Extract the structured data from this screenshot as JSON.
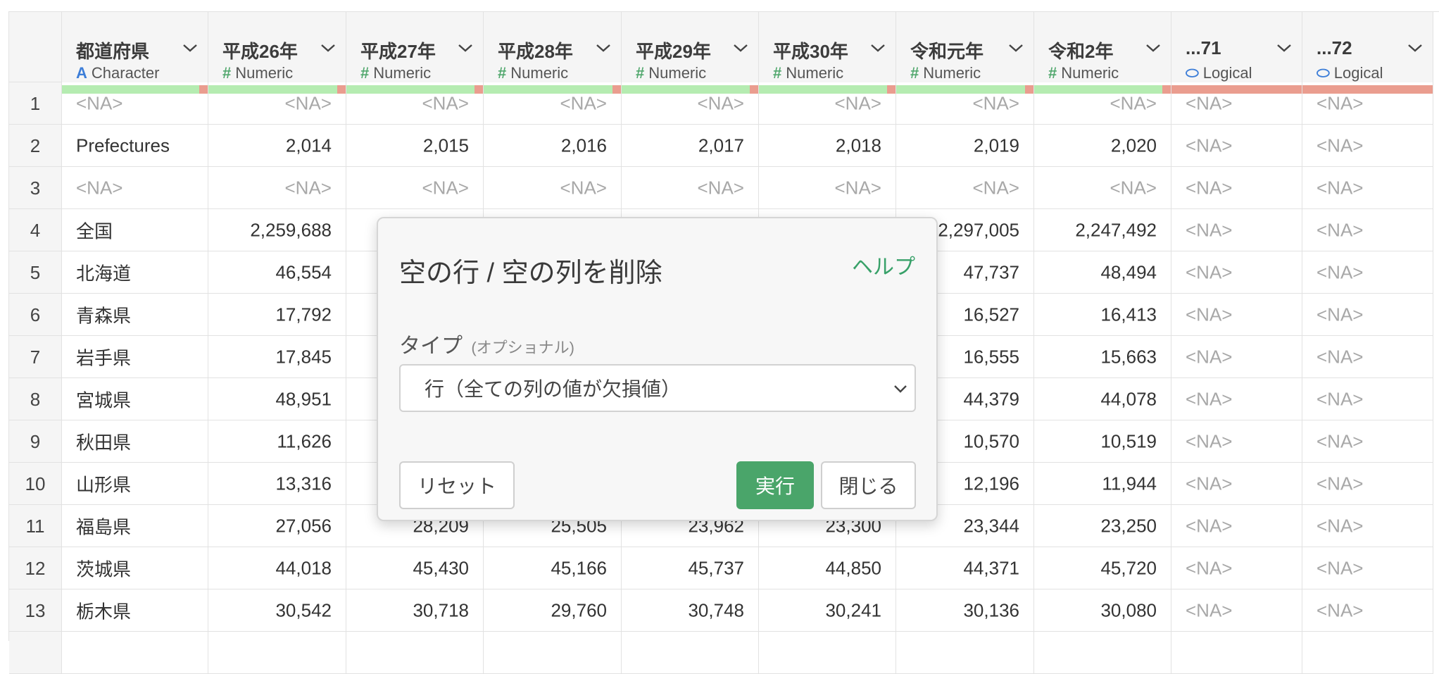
{
  "columns": [
    {
      "name": "都道府県",
      "type_label": "Character",
      "type_icon": "A",
      "type_icon_name": "character-type-icon",
      "icon_color": "#3d7ed8",
      "align": "left",
      "bar": [
        [
          "#b5ecb1",
          0.94
        ],
        [
          "#ea9d8f",
          0.06
        ]
      ]
    },
    {
      "name": "平成26年",
      "type_label": "Numeric",
      "type_icon": "#",
      "type_icon_name": "numeric-type-icon",
      "icon_color": "#52a86e",
      "align": "right",
      "bar": [
        [
          "#b5ecb1",
          0.94
        ],
        [
          "#ea9d8f",
          0.06
        ]
      ]
    },
    {
      "name": "平成27年",
      "type_label": "Numeric",
      "type_icon": "#",
      "type_icon_name": "numeric-type-icon",
      "icon_color": "#52a86e",
      "align": "right",
      "bar": [
        [
          "#b5ecb1",
          0.94
        ],
        [
          "#ea9d8f",
          0.06
        ]
      ]
    },
    {
      "name": "平成28年",
      "type_label": "Numeric",
      "type_icon": "#",
      "type_icon_name": "numeric-type-icon",
      "icon_color": "#52a86e",
      "align": "right",
      "bar": [
        [
          "#b5ecb1",
          0.94
        ],
        [
          "#ea9d8f",
          0.06
        ]
      ]
    },
    {
      "name": "平成29年",
      "type_label": "Numeric",
      "type_icon": "#",
      "type_icon_name": "numeric-type-icon",
      "icon_color": "#52a86e",
      "align": "right",
      "bar": [
        [
          "#b5ecb1",
          0.94
        ],
        [
          "#ea9d8f",
          0.06
        ]
      ]
    },
    {
      "name": "平成30年",
      "type_label": "Numeric",
      "type_icon": "#",
      "type_icon_name": "numeric-type-icon",
      "icon_color": "#52a86e",
      "align": "right",
      "bar": [
        [
          "#b5ecb1",
          0.94
        ],
        [
          "#ea9d8f",
          0.06
        ]
      ]
    },
    {
      "name": "令和元年",
      "type_label": "Numeric",
      "type_icon": "#",
      "type_icon_name": "numeric-type-icon",
      "icon_color": "#52a86e",
      "align": "right",
      "bar": [
        [
          "#b5ecb1",
          0.94
        ],
        [
          "#ea9d8f",
          0.06
        ]
      ]
    },
    {
      "name": "令和2年",
      "type_label": "Numeric",
      "type_icon": "#",
      "type_icon_name": "numeric-type-icon",
      "icon_color": "#52a86e",
      "align": "right",
      "bar": [
        [
          "#b5ecb1",
          0.94
        ],
        [
          "#ea9d8f",
          0.06
        ]
      ]
    },
    {
      "name": "...71",
      "type_label": "Logical",
      "type_icon": "⬭",
      "type_icon_name": "logical-type-icon",
      "icon_color": "#3d7ed8",
      "align": "left",
      "bar": [
        [
          "#ea9d8f",
          1.0
        ]
      ]
    },
    {
      "name": "...72",
      "type_label": "Logical",
      "type_icon": "⬭",
      "type_icon_name": "logical-type-icon",
      "icon_color": "#3d7ed8",
      "align": "left",
      "bar": [
        [
          "#ea9d8f",
          1.0
        ]
      ]
    }
  ],
  "rows": [
    [
      "1",
      "<NA>",
      "<NA>",
      "<NA>",
      "<NA>",
      "<NA>",
      "<NA>",
      "<NA>",
      "<NA>",
      "<NA>",
      "<NA>"
    ],
    [
      "2",
      "Prefectures",
      "2,014",
      "2,015",
      "2,016",
      "2,017",
      "2,018",
      "2,019",
      "2,020",
      "<NA>",
      "<NA>"
    ],
    [
      "3",
      "<NA>",
      "<NA>",
      "<NA>",
      "<NA>",
      "<NA>",
      "<NA>",
      "<NA>",
      "<NA>",
      "<NA>",
      "<NA>"
    ],
    [
      "4",
      "全国",
      "2,259,688",
      "",
      "",
      "",
      "",
      "2,297,005",
      "2,247,492",
      "<NA>",
      "<NA>"
    ],
    [
      "5",
      "北海道",
      "46,554",
      "",
      "",
      "",
      "",
      "47,737",
      "48,494",
      "<NA>",
      "<NA>"
    ],
    [
      "6",
      "青森県",
      "17,792",
      "",
      "",
      "",
      "",
      "16,527",
      "16,413",
      "<NA>",
      "<NA>"
    ],
    [
      "7",
      "岩手県",
      "17,845",
      "",
      "",
      "",
      "",
      "16,555",
      "15,663",
      "<NA>",
      "<NA>"
    ],
    [
      "8",
      "宮城県",
      "48,951",
      "",
      "",
      "",
      "",
      "44,379",
      "44,078",
      "<NA>",
      "<NA>"
    ],
    [
      "9",
      "秋田県",
      "11,626",
      "",
      "",
      "",
      "",
      "10,570",
      "10,519",
      "<NA>",
      "<NA>"
    ],
    [
      "10",
      "山形県",
      "13,316",
      "",
      "",
      "",
      "",
      "12,196",
      "11,944",
      "<NA>",
      "<NA>"
    ],
    [
      "11",
      "福島県",
      "27,056",
      "28,209",
      "25,505",
      "23,962",
      "23,300",
      "23,344",
      "23,250",
      "<NA>",
      "<NA>"
    ],
    [
      "12",
      "茨城県",
      "44,018",
      "45,430",
      "45,166",
      "45,737",
      "44,850",
      "44,371",
      "45,720",
      "<NA>",
      "<NA>"
    ],
    [
      "13",
      "栃木県",
      "30,542",
      "30,718",
      "29,760",
      "30,748",
      "30,241",
      "30,136",
      "30,080",
      "<NA>",
      "<NA>"
    ],
    [
      "",
      "",
      "",
      "",
      "",
      "",
      "",
      "",
      "",
      "",
      ""
    ]
  ],
  "dialog": {
    "title": "空の行 / 空の列を削除",
    "help_link": "ヘルプ",
    "type_label": "タイプ",
    "type_optional": "(オプショナル)",
    "type_value": "行（全ての列の値が欠損値）",
    "reset_button": "リセット",
    "run_button": "実行",
    "close_button": "閉じる"
  }
}
